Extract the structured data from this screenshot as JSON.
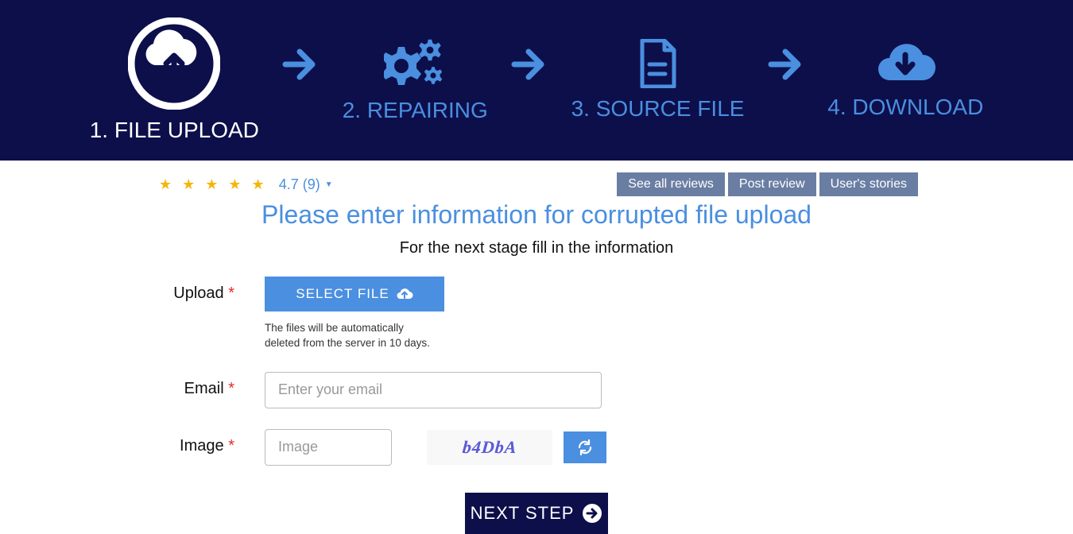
{
  "steps": {
    "s1": "1. FILE UPLOAD",
    "s2": "2. REPAIRING",
    "s3": "3. SOURCE FILE",
    "s4": "4. DOWNLOAD"
  },
  "reviews": {
    "rating": "4.7 (9)",
    "see_all": "See all reviews",
    "post": "Post review",
    "stories": "User's stories"
  },
  "headings": {
    "main": "Please enter information for corrupted file upload",
    "sub": "For the next stage fill in the information"
  },
  "form": {
    "upload_label": "Upload ",
    "select_file": "SELECT FILE",
    "helper": "The files will be automatically deleted from the server in 10 days.",
    "email_label": "Email ",
    "email_placeholder": "Enter your email",
    "image_label": "Image ",
    "image_placeholder": "Image",
    "captcha_value": "b4DbA",
    "next": "NEXT STEP"
  }
}
